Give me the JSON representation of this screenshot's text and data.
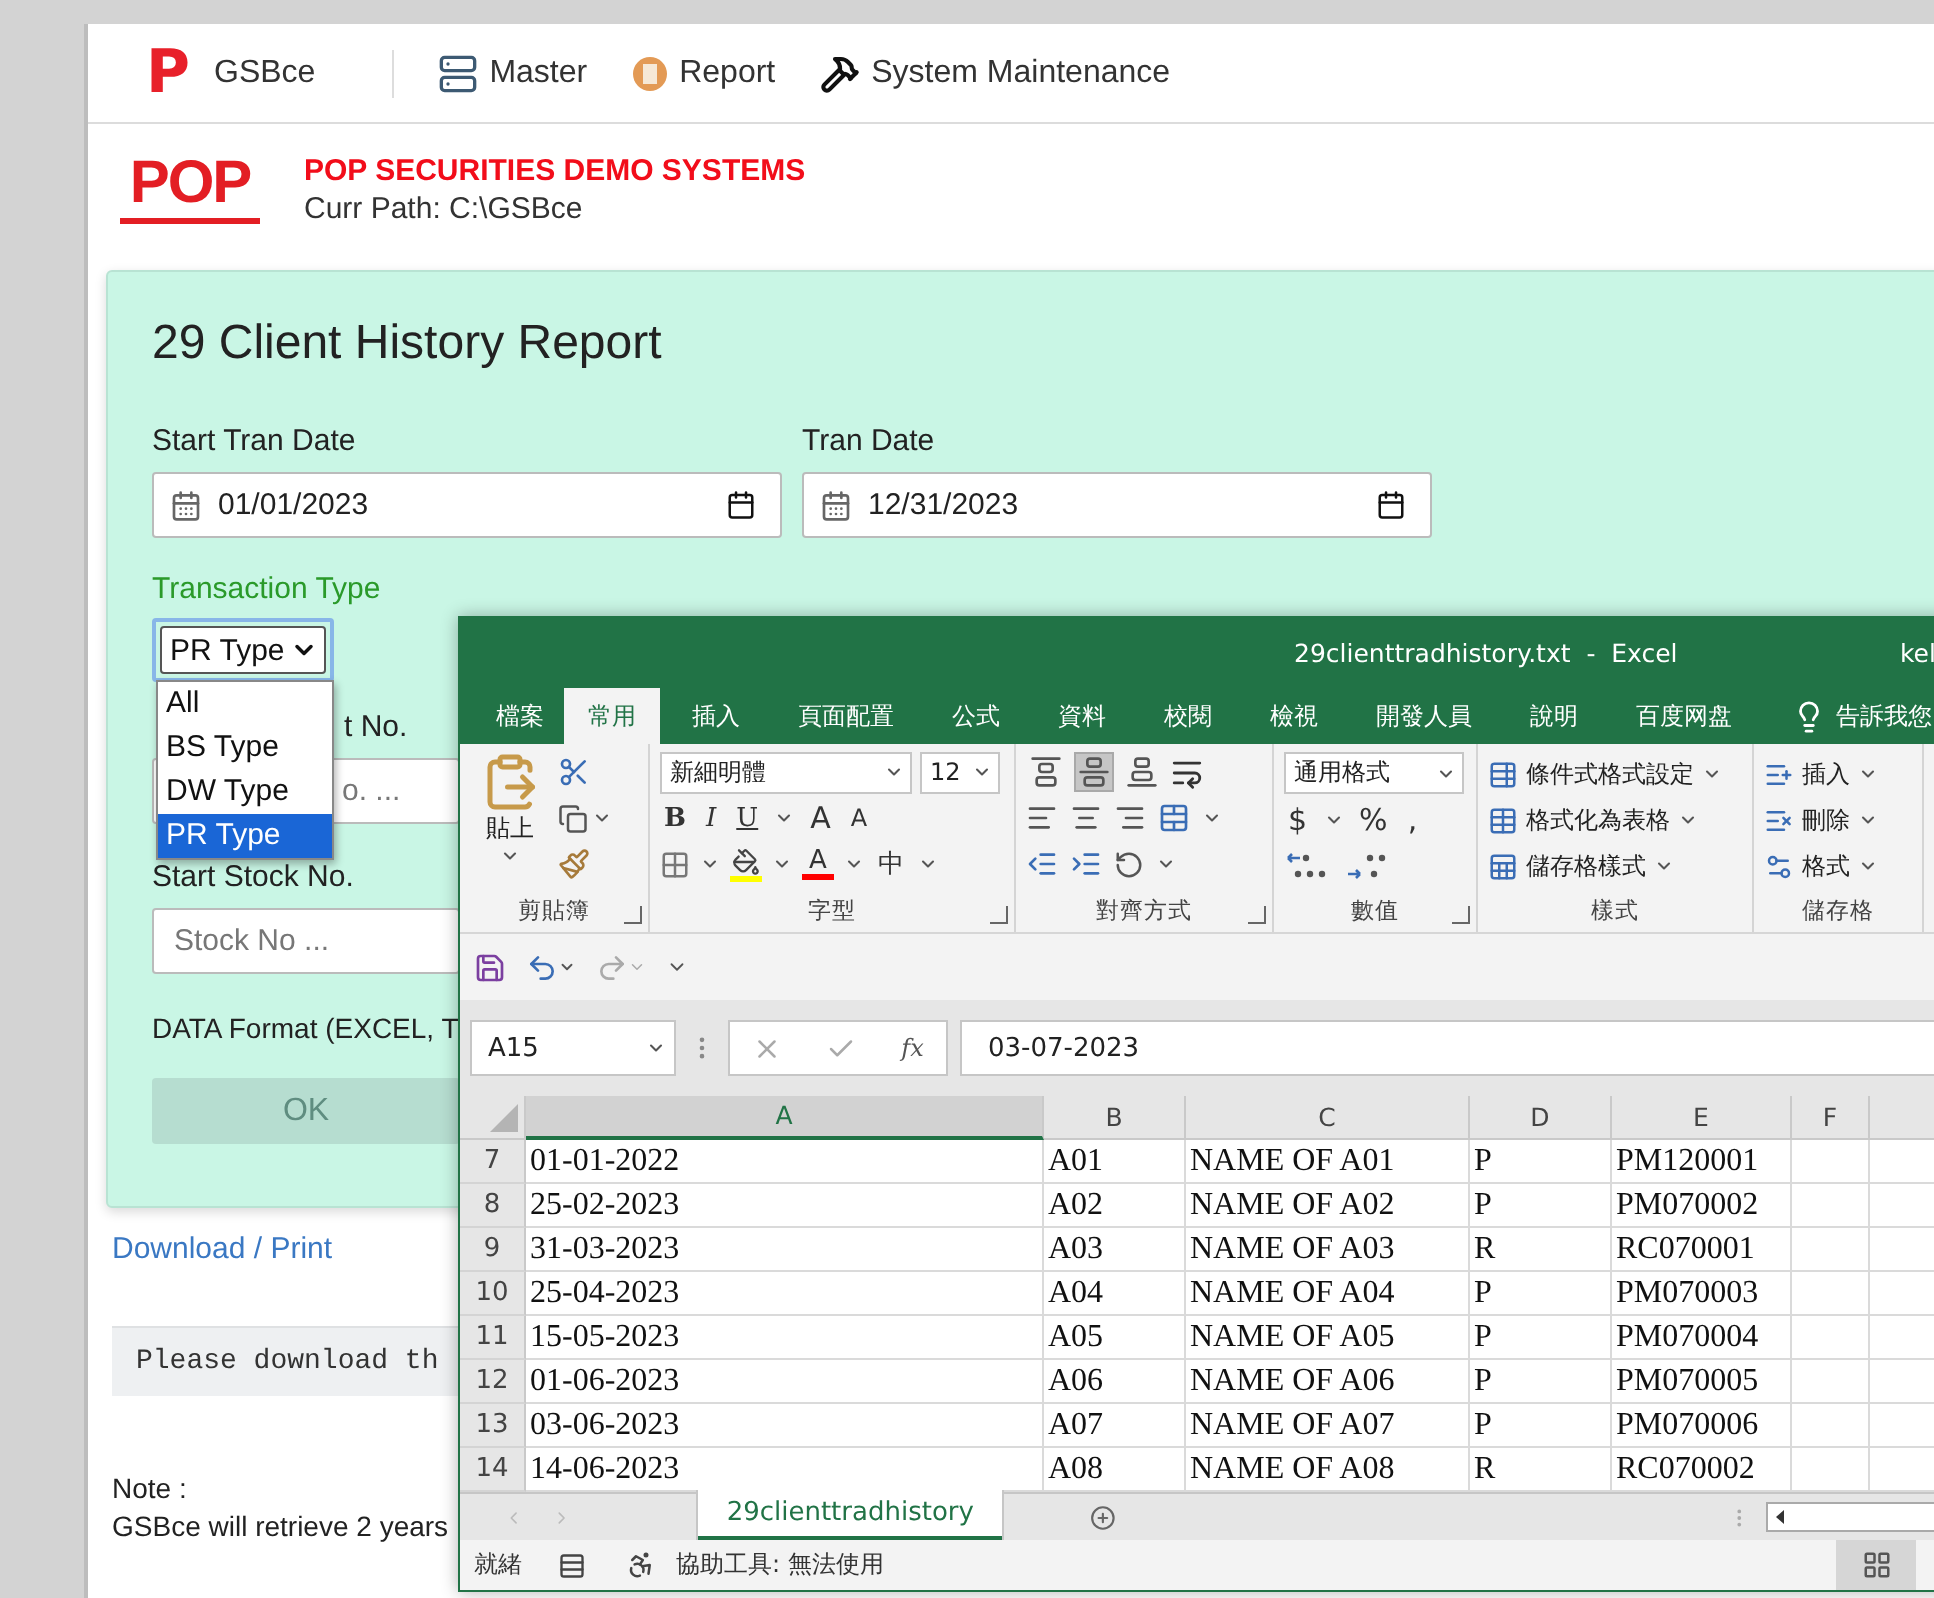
{
  "nav": {
    "brand_mark": "P",
    "brand": "GSBce",
    "items": [
      {
        "label": "Master",
        "kind": "master"
      },
      {
        "label": "Report",
        "kind": "report"
      },
      {
        "label": "System Maintenance",
        "kind": "maintenance"
      }
    ]
  },
  "header": {
    "logo_text": "POP",
    "title": "POP SECURITIES DEMO SYSTEMS",
    "path": "Curr Path: C:\\GSBce"
  },
  "report": {
    "title": "29 Client History Report",
    "start_date": {
      "label": "Start Tran Date",
      "value": "01/01/2023"
    },
    "end_date": {
      "label": "Tran Date",
      "value": "12/31/2023"
    },
    "transaction_type": {
      "label": "Transaction Type",
      "value": "PR Type",
      "expanded": true,
      "options": [
        {
          "label": "All",
          "selected": false
        },
        {
          "label": "BS Type",
          "selected": false
        },
        {
          "label": "DW Type",
          "selected": false
        },
        {
          "label": "PR Type",
          "selected": true
        }
      ]
    },
    "client_no": {
      "label": "t No.",
      "placeholder": "o. ..."
    },
    "stock_no": {
      "label": "Start Stock No.",
      "placeholder": "Stock No ..."
    },
    "format_label": "DATA Format (EXCEL, T",
    "ok_button": {
      "label": "OK",
      "disabled": true
    }
  },
  "download_link": "Download / Print",
  "notice": "Please download th",
  "note": {
    "heading": "Note :",
    "text": "GSBce will retrieve 2 years"
  },
  "excel": {
    "title": "29clienttradhistory.txt  -  Excel",
    "user": "kel",
    "tabs": [
      {
        "label": "檔案",
        "selected": false
      },
      {
        "label": "常用",
        "selected": true
      },
      {
        "label": "插入",
        "selected": false
      },
      {
        "label": "頁面配置",
        "selected": false
      },
      {
        "label": "公式",
        "selected": false
      },
      {
        "label": "資料",
        "selected": false
      },
      {
        "label": "校閱",
        "selected": false
      },
      {
        "label": "檢視",
        "selected": false
      },
      {
        "label": "開發人員",
        "selected": false
      },
      {
        "label": "說明",
        "selected": false
      },
      {
        "label": "百度网盘",
        "selected": false
      }
    ],
    "tell_me": "告訴我您",
    "ribbon": [
      {
        "kind": "clipboard",
        "label": "剪貼簿",
        "launcher": true,
        "paste": "貼上"
      },
      {
        "kind": "font",
        "label": "字型",
        "launcher": true,
        "font": "新細明體",
        "size": "12",
        "style_buttons": [
          "B",
          "I",
          "U"
        ],
        "size_buttons": [
          "A",
          "A"
        ],
        "font_color": "A",
        "phonetic": "中"
      },
      {
        "kind": "alignment",
        "label": "對齊方式",
        "launcher": true
      },
      {
        "kind": "number",
        "label": "數值",
        "launcher": true,
        "format": "通用格式",
        "symbols": [
          "$",
          "%",
          ","
        ]
      },
      {
        "kind": "styles",
        "label": "樣式",
        "launcher": false,
        "items": [
          "條件式格式設定",
          "格式化為表格",
          "儲存格樣式"
        ]
      },
      {
        "kind": "cells",
        "label": "儲存格",
        "launcher": false,
        "items": [
          "插入",
          "刪除",
          "格式"
        ]
      }
    ],
    "name_box": "A15",
    "function_label": "fx",
    "formula": "03-07-2023",
    "columns": [
      {
        "label": "A",
        "selected": true
      },
      {
        "label": "B",
        "selected": false
      },
      {
        "label": "C",
        "selected": false
      },
      {
        "label": "D",
        "selected": false
      },
      {
        "label": "E",
        "selected": false
      },
      {
        "label": "F",
        "selected": false
      }
    ],
    "rows": [
      {
        "number": "7",
        "cells": [
          "01-01-2022",
          "A01",
          "NAME OF A01",
          "P",
          "PM120001"
        ]
      },
      {
        "number": "8",
        "cells": [
          "25-02-2023",
          "A02",
          "NAME OF A02",
          "P",
          "PM070002"
        ]
      },
      {
        "number": "9",
        "cells": [
          "31-03-2023",
          "A03",
          "NAME OF A03",
          "R",
          "RC070001"
        ]
      },
      {
        "number": "10",
        "cells": [
          "25-04-2023",
          "A04",
          "NAME OF A04",
          "P",
          "PM070003"
        ]
      },
      {
        "number": "11",
        "cells": [
          "15-05-2023",
          "A05",
          "NAME OF A05",
          "P",
          "PM070004"
        ]
      },
      {
        "number": "12",
        "cells": [
          "01-06-2023",
          "A06",
          "NAME OF A06",
          "P",
          "PM070005"
        ]
      },
      {
        "number": "13",
        "cells": [
          "03-06-2023",
          "A07",
          "NAME OF A07",
          "P",
          "PM070006"
        ]
      },
      {
        "number": "14",
        "cells": [
          "14-06-2023",
          "A08",
          "NAME OF A08",
          "R",
          "RC070002"
        ]
      }
    ],
    "sheet_tab": {
      "label": "29clienttradhistory",
      "selected": true
    },
    "status": {
      "ready": "就緒",
      "accessibility": "協助工具: 無法使用"
    }
  }
}
